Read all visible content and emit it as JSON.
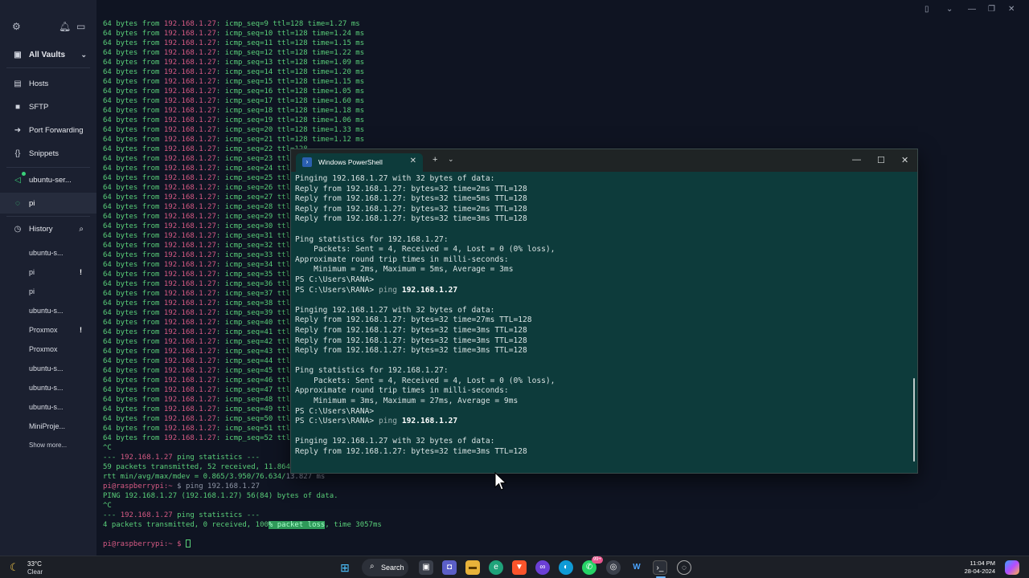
{
  "sidebar": {
    "vault_label": "All Vaults",
    "nav": [
      {
        "label": "Hosts"
      },
      {
        "label": "SFTP"
      },
      {
        "label": "Port Forwarding"
      },
      {
        "label": "Snippets"
      }
    ],
    "sessions": [
      {
        "label": "ubuntu-ser..."
      },
      {
        "label": "pi"
      }
    ],
    "history_label": "History",
    "history": [
      {
        "label": "ubuntu-s...",
        "warn": ""
      },
      {
        "label": "pi",
        "warn": "!"
      },
      {
        "label": "pi",
        "warn": ""
      },
      {
        "label": "ubuntu-s...",
        "warn": ""
      },
      {
        "label": "Proxmox",
        "warn": "!"
      },
      {
        "label": "Proxmox",
        "warn": ""
      },
      {
        "label": "ubuntu-s...",
        "warn": ""
      },
      {
        "label": "ubuntu-s...",
        "warn": ""
      },
      {
        "label": "ubuntu-s...",
        "warn": ""
      },
      {
        "label": "MiniProje...",
        "warn": ""
      }
    ],
    "show_more": "Show more..."
  },
  "terminal": {
    "ip": "192.168.1.27",
    "ping_lines": [
      {
        "seq": "9",
        "time": "1.27"
      },
      {
        "seq": "10",
        "time": "1.24"
      },
      {
        "seq": "11",
        "time": "1.15"
      },
      {
        "seq": "12",
        "time": "1.22"
      },
      {
        "seq": "13",
        "time": "1.09"
      },
      {
        "seq": "14",
        "time": "1.20"
      },
      {
        "seq": "15",
        "time": "1.15"
      },
      {
        "seq": "16",
        "time": "1.05"
      },
      {
        "seq": "17",
        "time": "1.60"
      },
      {
        "seq": "18",
        "time": "1.18"
      },
      {
        "seq": "19",
        "time": "1.06"
      },
      {
        "seq": "20",
        "time": "1.33"
      },
      {
        "seq": "21",
        "time": "1.12"
      },
      {
        "seq": "22",
        "time": ""
      },
      {
        "seq": "23",
        "time": ""
      },
      {
        "seq": "24",
        "time": ""
      },
      {
        "seq": "25",
        "time": ""
      },
      {
        "seq": "26",
        "time": ""
      },
      {
        "seq": "27",
        "time": ""
      },
      {
        "seq": "28",
        "time": ""
      },
      {
        "seq": "29",
        "time": ""
      },
      {
        "seq": "30",
        "time": ""
      },
      {
        "seq": "31",
        "time": ""
      },
      {
        "seq": "32",
        "time": ""
      },
      {
        "seq": "33",
        "time": ""
      },
      {
        "seq": "34",
        "time": ""
      },
      {
        "seq": "35",
        "time": ""
      },
      {
        "seq": "36",
        "time": ""
      },
      {
        "seq": "37",
        "time": ""
      },
      {
        "seq": "38",
        "time": ""
      },
      {
        "seq": "39",
        "time": ""
      },
      {
        "seq": "40",
        "time": ""
      },
      {
        "seq": "41",
        "time": ""
      },
      {
        "seq": "42",
        "time": ""
      },
      {
        "seq": "43",
        "time": ""
      },
      {
        "seq": "44",
        "time": ""
      },
      {
        "seq": "45",
        "time": ""
      },
      {
        "seq": "46",
        "time": ""
      },
      {
        "seq": "47",
        "time": ""
      },
      {
        "seq": "48",
        "time": ""
      },
      {
        "seq": "49",
        "time": ""
      },
      {
        "seq": "50",
        "time": ""
      },
      {
        "seq": "51",
        "time": ""
      },
      {
        "seq": "52",
        "time": ""
      }
    ],
    "tail": [
      "^C",
      "--- 192.168.1.27 ping statistics ---",
      "59 packets transmitted, 52 received, 11.8644",
      "rtt min/avg/max/mdev = 0.865/3.950/76.634/13.827 ms",
      "pi@raspberrypi:~ $ ping 192.168.1.27",
      "PING 192.168.1.27 (192.168.1.27) 56(84) bytes of data.",
      "^C",
      "--- 192.168.1.27 ping statistics ---",
      "4 packets transmitted, 0 received, 100% packet loss, time 3057ms"
    ],
    "prompt": "pi@raspberrypi:~ $ "
  },
  "powershell": {
    "tab_title": "Windows PowerShell",
    "lines": [
      "Pinging 192.168.1.27 with 32 bytes of data:",
      "Reply from 192.168.1.27: bytes=32 time=2ms TTL=128",
      "Reply from 192.168.1.27: bytes=32 time=5ms TTL=128",
      "Reply from 192.168.1.27: bytes=32 time=2ms TTL=128",
      "Reply from 192.168.1.27: bytes=32 time=3ms TTL=128",
      "",
      "Ping statistics for 192.168.1.27:",
      "    Packets: Sent = 4, Received = 4, Lost = 0 (0% loss),",
      "Approximate round trip times in milli-seconds:",
      "    Minimum = 2ms, Maximum = 5ms, Average = 3ms",
      "PS C:\\Users\\RANA>",
      "PS C:\\Users\\RANA> ping 192.168.1.27",
      "",
      "Pinging 192.168.1.27 with 32 bytes of data:",
      "Reply from 192.168.1.27: bytes=32 time=27ms TTL=128",
      "Reply from 192.168.1.27: bytes=32 time=3ms TTL=128",
      "Reply from 192.168.1.27: bytes=32 time=3ms TTL=128",
      "Reply from 192.168.1.27: bytes=32 time=3ms TTL=128",
      "",
      "Ping statistics for 192.168.1.27:",
      "    Packets: Sent = 4, Received = 4, Lost = 0 (0% loss),",
      "Approximate round trip times in milli-seconds:",
      "    Minimum = 3ms, Maximum = 27ms, Average = 9ms",
      "PS C:\\Users\\RANA>",
      "PS C:\\Users\\RANA> ping 192.168.1.27",
      "",
      "Pinging 192.168.1.27 with 32 bytes of data:",
      "Reply from 192.168.1.27: bytes=32 time=3ms TTL=128"
    ]
  },
  "taskbar": {
    "temp": "33°C",
    "condition": "Clear",
    "search_label": "Search",
    "badge": "99+",
    "time": "11:04 PM",
    "date": "28-04-2024"
  },
  "colors": {
    "ps_background": "#0d3b3b",
    "terminal_green": "#5ad07a",
    "terminal_ip": "#d75a84",
    "sidebar_bg": "#1b2030"
  }
}
